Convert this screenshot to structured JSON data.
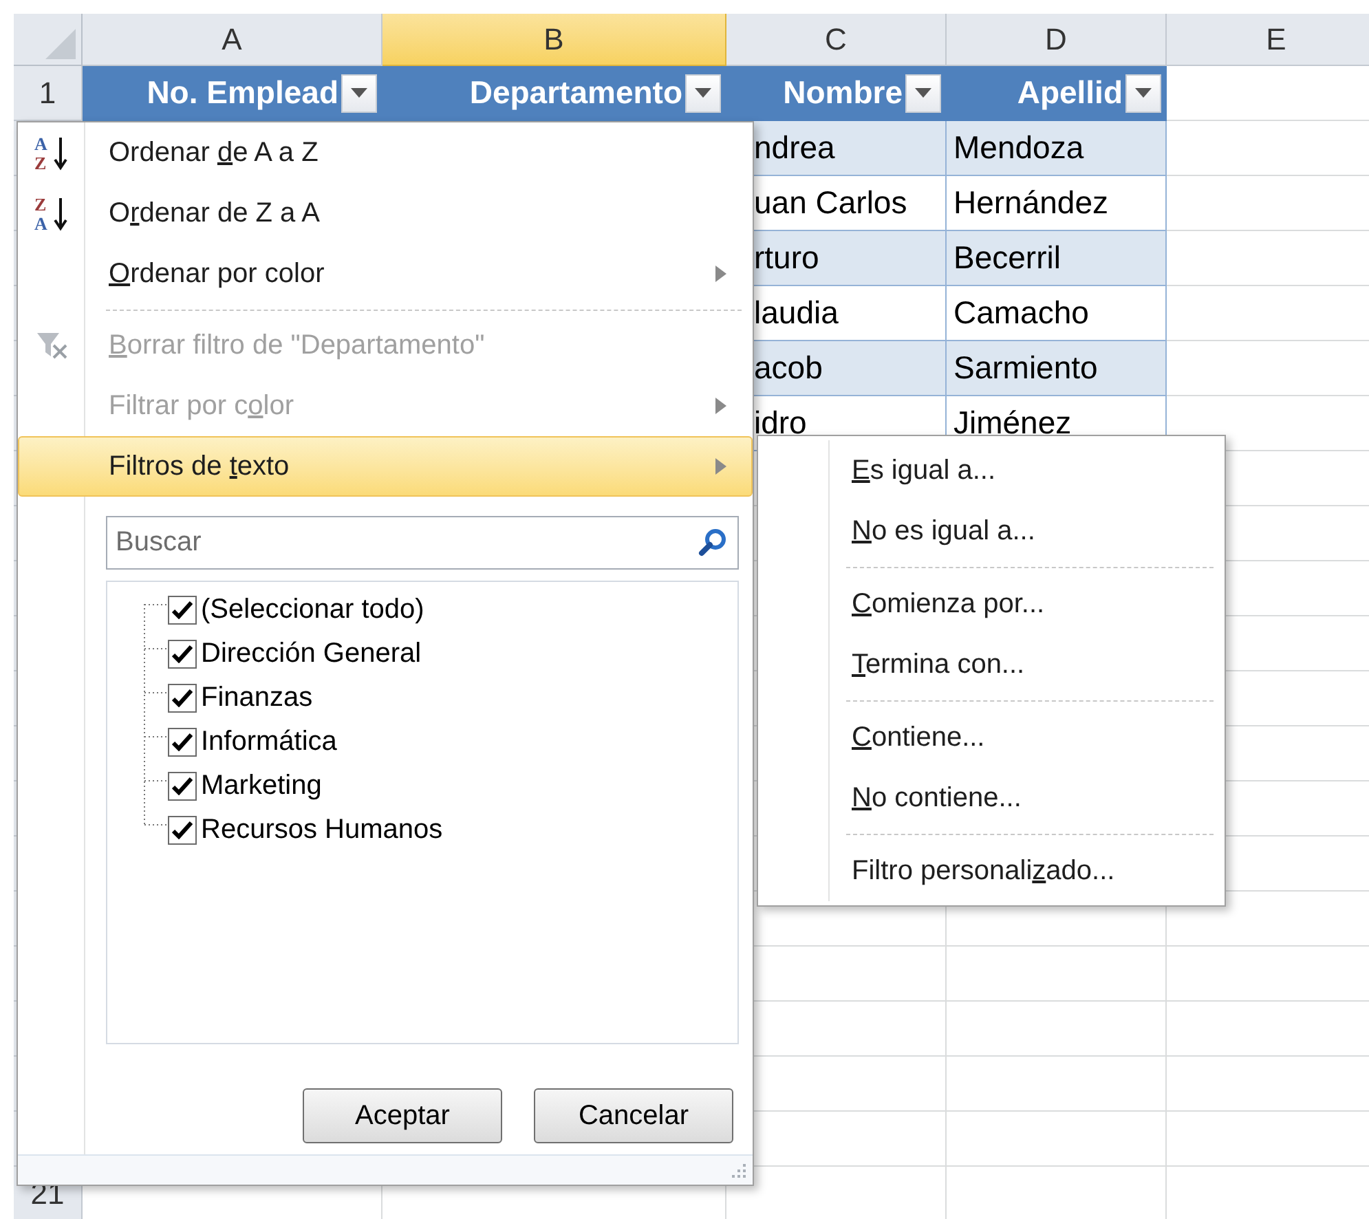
{
  "sheet": {
    "columns": [
      {
        "label": "A",
        "selected": false
      },
      {
        "label": "B",
        "selected": true
      },
      {
        "label": "C",
        "selected": false
      },
      {
        "label": "D",
        "selected": false
      },
      {
        "label": "E",
        "selected": false
      }
    ],
    "header_row": {
      "number": "1",
      "cells": [
        {
          "label": "No. Emplead",
          "filter": true
        },
        {
          "label": "Departamento",
          "filter": true
        },
        {
          "label": "Nombre",
          "filter": true
        },
        {
          "label": "Apellid",
          "filter": true
        }
      ]
    },
    "rows": [
      {
        "column_c": "ndrea",
        "column_d": "Mendoza"
      },
      {
        "column_c": "uan Carlos",
        "column_d": "Hernández"
      },
      {
        "column_c": "rturo",
        "column_d": "Becerril"
      },
      {
        "column_c": "laudia",
        "column_d": "Camacho"
      },
      {
        "column_c": "acob",
        "column_d": "Sarmiento"
      },
      {
        "column_c": "idro",
        "column_d": "Jiménez"
      }
    ],
    "last_row_number": "21"
  },
  "filter_menu": {
    "items": [
      {
        "kind": "command",
        "icon": {
          "kind": "sort",
          "top": "A",
          "bottom": "Z"
        },
        "label": [
          {
            "text": "Ordenar "
          },
          {
            "text": "d",
            "underline": true
          },
          {
            "text": "e A a Z"
          }
        ],
        "disabled": false,
        "submenu": false,
        "selected": false
      },
      {
        "kind": "command",
        "icon": {
          "kind": "sort",
          "top": "Z",
          "bottom": "A"
        },
        "label": [
          {
            "text": "O"
          },
          {
            "text": "r",
            "underline": true
          },
          {
            "text": "denar de Z a A"
          }
        ],
        "disabled": false,
        "submenu": false,
        "selected": false
      },
      {
        "kind": "command",
        "label": [
          {
            "text": "O",
            "underline": true
          },
          {
            "text": "rdenar por color"
          }
        ],
        "disabled": false,
        "submenu": true,
        "selected": false
      },
      {
        "kind": "separator"
      },
      {
        "kind": "command",
        "icon": {
          "kind": "clear_filter"
        },
        "label": [
          {
            "text": "B",
            "underline": true
          },
          {
            "text": "orrar filtro de \"Departamento\""
          }
        ],
        "disabled": true,
        "submenu": false,
        "selected": false
      },
      {
        "kind": "command",
        "label": [
          {
            "text": "Filtrar por c"
          },
          {
            "text": "o",
            "underline": true
          },
          {
            "text": "lor"
          }
        ],
        "disabled": true,
        "submenu": true,
        "selected": false
      },
      {
        "kind": "command",
        "label": [
          {
            "text": "Filtros de "
          },
          {
            "text": "t",
            "underline": true
          },
          {
            "text": "exto"
          }
        ],
        "disabled": false,
        "submenu": true,
        "selected": true
      }
    ],
    "search": {
      "placeholder": "Buscar"
    },
    "values": [
      {
        "label": "(Seleccionar todo)",
        "checked": true
      },
      {
        "label": "Dirección General",
        "checked": true
      },
      {
        "label": "Finanzas",
        "checked": true
      },
      {
        "label": "Informática",
        "checked": true
      },
      {
        "label": "Marketing",
        "checked": true
      },
      {
        "label": "Recursos Humanos",
        "checked": true
      }
    ],
    "buttons": [
      "Aceptar",
      "Cancelar"
    ]
  },
  "text_filters_menu": {
    "items": [
      {
        "kind": "command",
        "label": [
          {
            "text": "E",
            "underline": true
          },
          {
            "text": "s igual a..."
          }
        ]
      },
      {
        "kind": "command",
        "label": [
          {
            "text": "N",
            "underline": true
          },
          {
            "text": "o es igual a..."
          }
        ]
      },
      {
        "kind": "separator"
      },
      {
        "kind": "command",
        "label": [
          {
            "text": "C",
            "underline": true
          },
          {
            "text": "omienza por..."
          }
        ]
      },
      {
        "kind": "command",
        "label": [
          {
            "text": "T",
            "underline": true
          },
          {
            "text": "ermina con..."
          }
        ]
      },
      {
        "kind": "separator"
      },
      {
        "kind": "command",
        "label": [
          {
            "text": "C",
            "underline": true
          },
          {
            "text": "ontiene..."
          }
        ]
      },
      {
        "kind": "command",
        "label": [
          {
            "text": "N",
            "underline": true
          },
          {
            "text": "o contiene..."
          }
        ]
      },
      {
        "kind": "separator"
      },
      {
        "kind": "command",
        "label": [
          {
            "text": "Filtro personali"
          },
          {
            "text": "z",
            "underline": true
          },
          {
            "text": "ado..."
          }
        ]
      }
    ]
  }
}
